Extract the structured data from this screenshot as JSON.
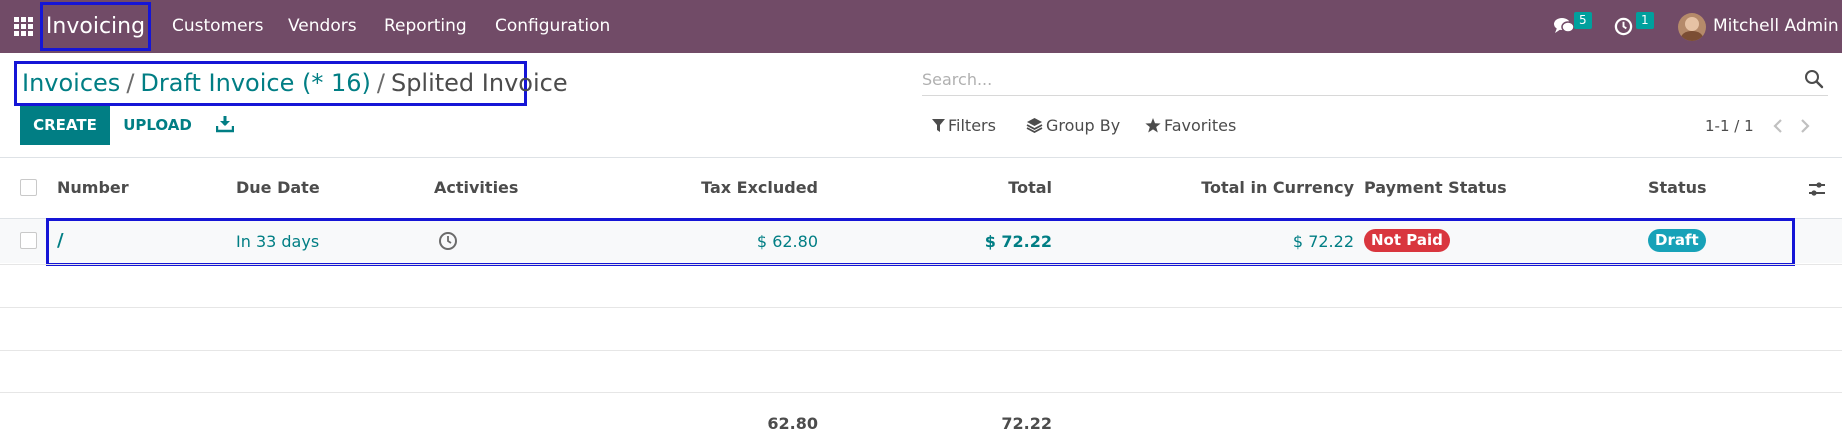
{
  "navbar": {
    "app_name": "Invoicing",
    "menu": [
      "Customers",
      "Vendors",
      "Reporting",
      "Configuration"
    ],
    "messages_count": "5",
    "activities_count": "1",
    "user": "Mitchell Admin",
    "bg_color": "#714b67"
  },
  "breadcrumb": {
    "items": [
      "Invoices",
      "Draft Invoice (* 16)"
    ],
    "current": "Splited Invoice"
  },
  "search": {
    "placeholder": "Search..."
  },
  "toolbar": {
    "create_label": "CREATE",
    "upload_label": "UPLOAD",
    "filters_label": "Filters",
    "groupby_label": "Group By",
    "favorites_label": "Favorites",
    "pager": "1-1 / 1"
  },
  "table": {
    "headers": [
      "Number",
      "Due Date",
      "Activities",
      "Tax Excluded",
      "Total",
      "Total in Currency",
      "Payment Status",
      "Status"
    ],
    "rows": [
      {
        "number": "/",
        "due_date": "In 33 days",
        "activity_icon": "clock-icon",
        "tax_excluded": "$ 62.80",
        "total": "$ 72.22",
        "total_currency": "$ 72.22",
        "payment_status": "Not Paid",
        "status": "Draft"
      }
    ],
    "footer": {
      "tax_excluded": "62.80",
      "total": "72.22"
    }
  },
  "colors": {
    "accent": "#017e84",
    "not_paid": "#d9363e",
    "draft": "#17a2b8",
    "annotation_box": "#1515d6"
  }
}
